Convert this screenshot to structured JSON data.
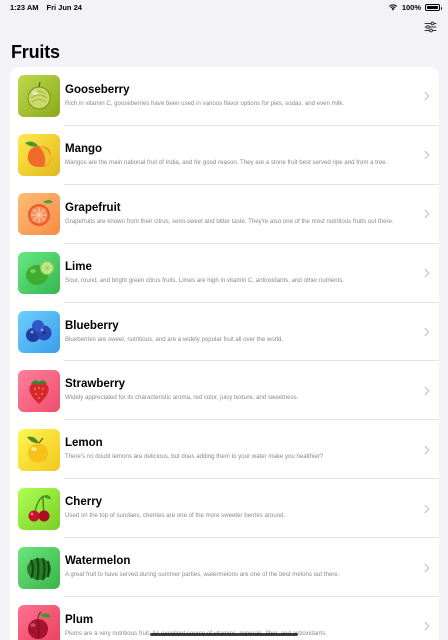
{
  "status": {
    "time": "1:23 AM",
    "date": "Fri Jun 24",
    "battery": "100%"
  },
  "nav": {
    "title": "Fruits",
    "filter_icon": "sliders-icon"
  },
  "fruits": [
    {
      "name": "Gooseberry",
      "description": "Rich in vitamin C, gooseberries have been used in various flavor options for pies, sodas, and even milk.",
      "icon": "gooseberry-icon",
      "color": "#8aa81c"
    },
    {
      "name": "Mango",
      "description": "Mangos are the main national fruit of India, and for good reason. They are a stone fruit best served ripe and from a tree.",
      "icon": "mango-icon",
      "color": "#e2b71b"
    },
    {
      "name": "Grapefruit",
      "description": "Grapefruits are known from their citrus, semi-sweet and bitter taste. They're also one of the most nutritious fruits out there.",
      "icon": "grapefruit-icon",
      "color": "#f58b45"
    },
    {
      "name": "Lime",
      "description": "Sour, round, and bright green citrus fruits. Limes are high in vitamin C, antioxidants, and other nutrients.",
      "icon": "lime-icon",
      "color": "#35b650"
    },
    {
      "name": "Blueberry",
      "description": "Blueberries are sweet, nutritious, and are a widely popular fruit all over the world.",
      "icon": "blueberry-icon",
      "color": "#3a9de8"
    },
    {
      "name": "Strawberry",
      "description": "Widely appreciated for its characteristic aroma, red color, juicy texture, and sweetness.",
      "icon": "strawberry-icon",
      "color": "#ee4d6c"
    },
    {
      "name": "Lemon",
      "description": "There's no doubt lemons are delicious, but does adding them to your water make you healthier?",
      "icon": "lemon-icon",
      "color": "#f3c51f"
    },
    {
      "name": "Cherry",
      "description": "Used on the top of sundaes, cherries are one of the more sweeter berries around.",
      "icon": "cherry-icon",
      "color": "#7ccd22"
    },
    {
      "name": "Watermelon",
      "description": "A great fruit to have served during summer parties, watermelons are one of the best melons out there.",
      "icon": "watermelon-icon",
      "color": "#3ab44a"
    },
    {
      "name": "Plum",
      "description": "Plums are a very nutritious fruit. An excellent source of vitamins, minerals, fiber, and antioxidants.",
      "icon": "plum-icon",
      "color": "#e8405e"
    }
  ]
}
